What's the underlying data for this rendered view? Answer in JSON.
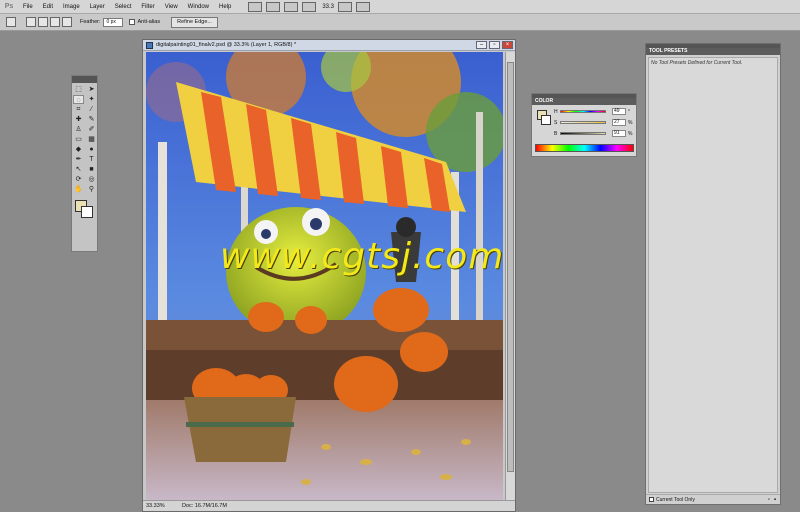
{
  "menubar": {
    "logo": "Ps",
    "items": [
      "File",
      "Edit",
      "Image",
      "Layer",
      "Select",
      "Filter",
      "View",
      "Window",
      "Help"
    ],
    "zoom": "33.3"
  },
  "options": {
    "feather_label": "Feather:",
    "feather_value": "0 px",
    "antialias_label": "Anti-alias",
    "refine_button": "Refine Edge..."
  },
  "toolbox": {
    "fg_color": "#e9e0b4",
    "bg_color": "#ffffff"
  },
  "document": {
    "title": "digitalpainting01_finalv2.psd @ 33.3% (Layer 1, RGB/8) *",
    "zoom": "33.33%",
    "doc_info": "Doc: 16.7M/16.7M"
  },
  "color_panel": {
    "title": "COLOR",
    "h_label": "H",
    "h_value": "49",
    "h_unit": "°",
    "s_label": "S",
    "s_value": "27",
    "s_unit": "%",
    "b_label": "B",
    "b_value": "91",
    "b_unit": "%"
  },
  "tool_presets": {
    "title": "TOOL PRESETS",
    "message": "No Tool Presets Defined for Current Tool.",
    "current_only_label": "Current Tool Only"
  },
  "watermark": "www.cgtsj.com"
}
